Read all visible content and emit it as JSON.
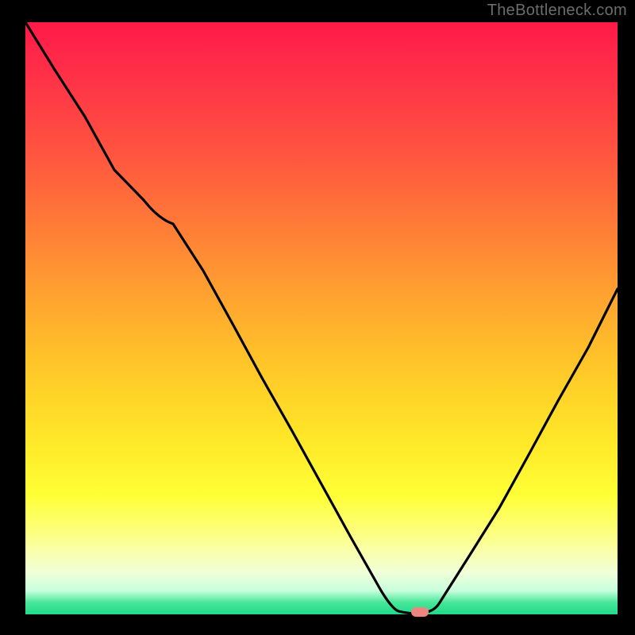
{
  "watermark": "TheBottleneck.com",
  "colors": {
    "background": "#000000",
    "curve": "#000000",
    "marker": "#ee857f",
    "gradient_top": "#ff1948",
    "gradient_bottom": "#1fdc8a"
  },
  "chart_data": {
    "type": "line",
    "title": "",
    "xlabel": "",
    "ylabel": "",
    "xlim": [
      0,
      100
    ],
    "ylim": [
      0,
      100
    ],
    "series": [
      {
        "name": "bottleneck-curve",
        "x": [
          0,
          5,
          10,
          15,
          20,
          25,
          30,
          35,
          40,
          45,
          50,
          55,
          60,
          62,
          65,
          68,
          70,
          75,
          80,
          85,
          90,
          95,
          100
        ],
        "y": [
          100,
          92,
          84,
          75,
          70,
          66,
          58,
          49,
          40,
          31,
          22,
          13,
          4,
          1,
          0,
          0,
          2,
          10,
          18,
          27,
          36,
          45,
          55
        ]
      }
    ],
    "marker": {
      "x": 66,
      "y": 0,
      "shape": "rounded-rect",
      "color": "#ee857f"
    }
  }
}
